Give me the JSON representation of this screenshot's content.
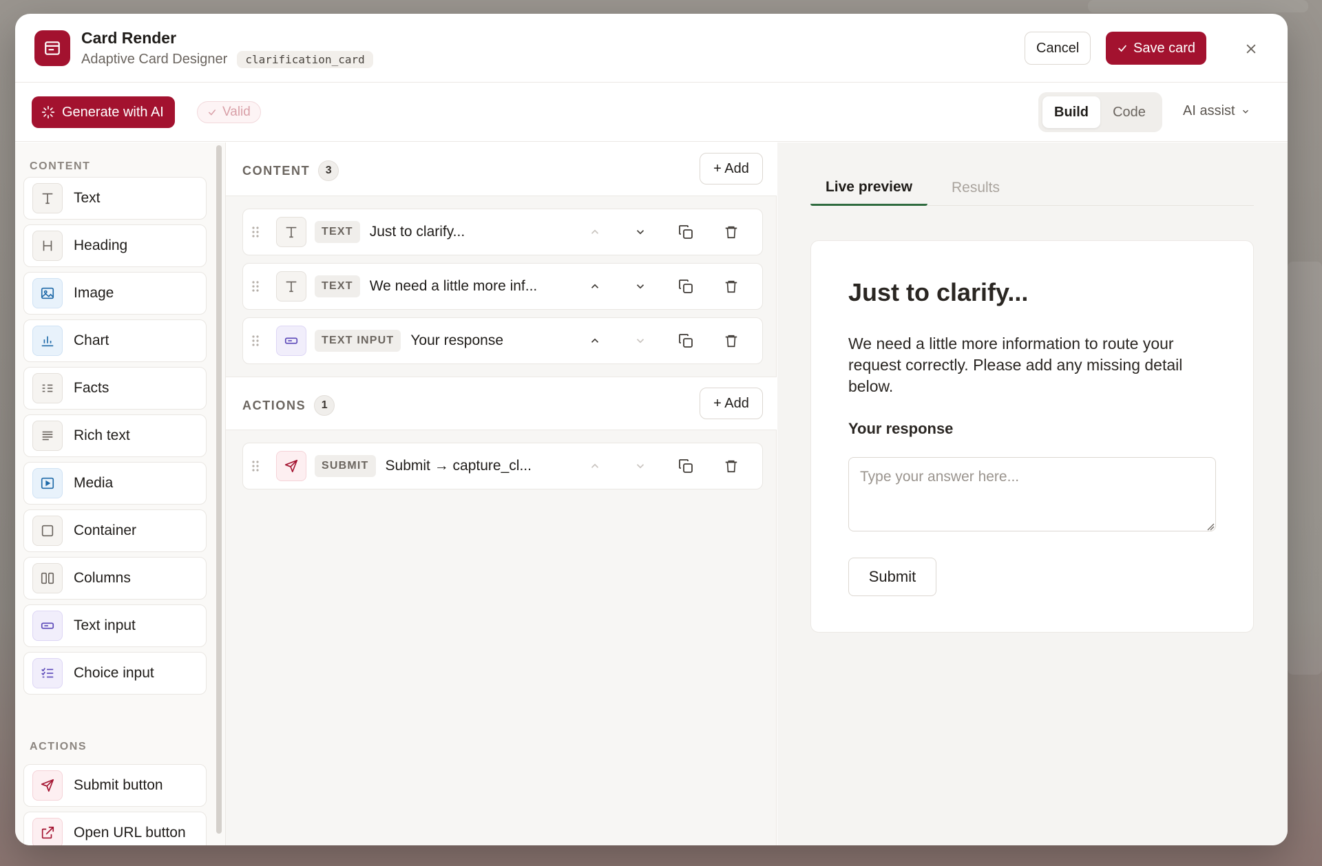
{
  "header": {
    "title": "Card Render",
    "subtitle": "Adaptive Card Designer",
    "card_id": "clarification_card",
    "cancel_label": "Cancel",
    "save_label": "Save card"
  },
  "toolbar": {
    "generate_label": "Generate with AI",
    "valid_label": "Valid",
    "modes": [
      "Build",
      "Code"
    ],
    "active_mode": "Build",
    "ai_assist_label": "AI assist"
  },
  "palette": {
    "content_heading": "CONTENT",
    "content_items": [
      {
        "label": "Text",
        "icon": "text-icon"
      },
      {
        "label": "Heading",
        "icon": "heading-icon"
      },
      {
        "label": "Image",
        "icon": "image-icon"
      },
      {
        "label": "Chart",
        "icon": "chart-icon"
      },
      {
        "label": "Facts",
        "icon": "facts-icon"
      },
      {
        "label": "Rich text",
        "icon": "rich-text-icon"
      },
      {
        "label": "Media",
        "icon": "media-icon"
      },
      {
        "label": "Container",
        "icon": "container-icon"
      },
      {
        "label": "Columns",
        "icon": "columns-icon"
      },
      {
        "label": "Text input",
        "icon": "text-input-icon"
      },
      {
        "label": "Choice input",
        "icon": "choice-input-icon"
      }
    ],
    "actions_heading": "ACTIONS",
    "action_items": [
      {
        "label": "Submit button",
        "icon": "send-icon"
      },
      {
        "label": "Open URL button",
        "icon": "external-link-icon"
      }
    ]
  },
  "structure": {
    "content_heading": "CONTENT",
    "content_count": "3",
    "add_label": "+ Add",
    "content_rows": [
      {
        "type": "TEXT",
        "label": "Just to clarify...",
        "icon": "text-icon"
      },
      {
        "type": "TEXT",
        "label": "We need a little more inf...",
        "icon": "text-icon"
      },
      {
        "type": "TEXT INPUT",
        "label": "Your response",
        "icon": "text-input-icon"
      }
    ],
    "actions_heading": "ACTIONS",
    "actions_count": "1",
    "action_rows": [
      {
        "type": "SUBMIT",
        "label": "Submit → capture_cl...",
        "icon": "send-icon"
      }
    ]
  },
  "preview": {
    "tabs": [
      "Live preview",
      "Results"
    ],
    "active_tab": "Live preview",
    "card_title": "Just to clarify...",
    "card_body": "We need a little more information to route your request correctly. Please add any missing detail below.",
    "input_label": "Your response",
    "input_placeholder": "Type your answer here...",
    "submit_label": "Submit"
  },
  "colors": {
    "brand": "#a3122f",
    "tab_accent": "#2f6b3f"
  }
}
